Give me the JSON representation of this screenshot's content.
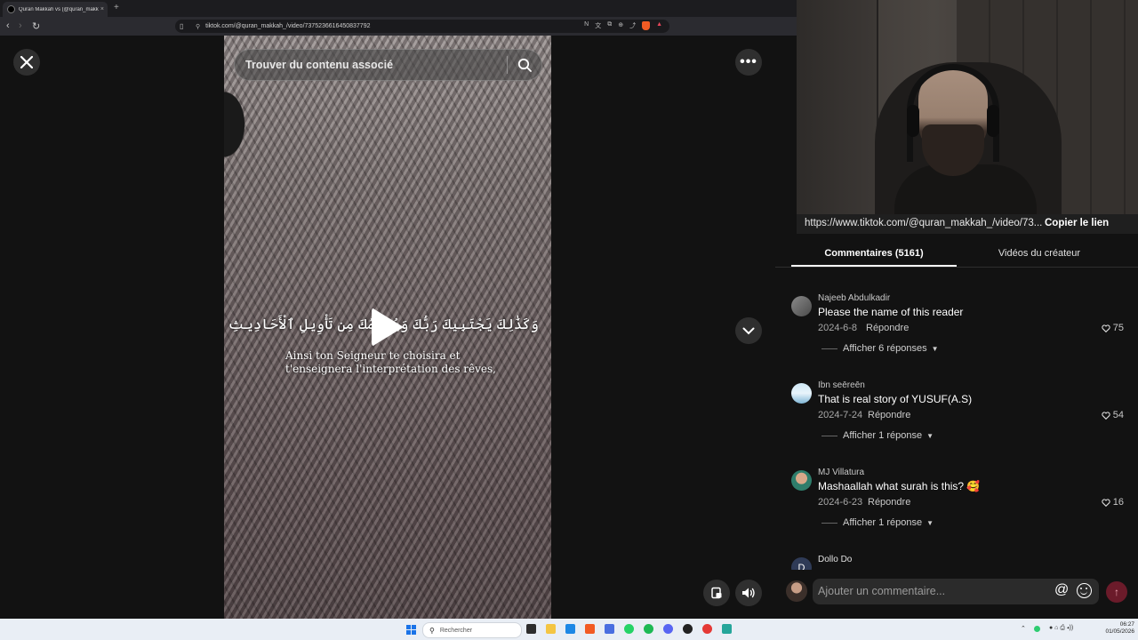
{
  "browser": {
    "tab_title": "Quran Makkah vs (@quran_makk",
    "tab_close": "×",
    "new_tab": "+",
    "back": "‹",
    "forward": "›",
    "reload": "↻",
    "url": "tiktok.com/@quran_makkah_/video/7375236616450837792"
  },
  "video": {
    "search_placeholder": "Trouver du contenu associé",
    "arabic_caption": "وَكَذَٰلِكَ يَجْتَبِيكَ رَبُّكَ وَيُعَلِّمُكَ مِن تَأْوِيلِ ٱلْأَحَادِيثِ",
    "subtitle_line1": "Ainsi ton Seigneur te choisira et",
    "subtitle_line2": "t'enseignera l'interprétation des rêves,"
  },
  "share": {
    "url": "https://www.tiktok.com/@quran_makkah_/video/73...",
    "copy_label": "Copier le lien"
  },
  "tabs": {
    "comments": "Commentaires (5161)",
    "creator_videos": "Vidéos du créateur"
  },
  "comments": [
    {
      "user": "Najeeb Abdulkadir",
      "text": "Please the name of this reader",
      "date": "2024-6-8",
      "reply": "Répondre",
      "likes": "75",
      "more": "Afficher 6 réponses"
    },
    {
      "user": "Ibn seēreēn",
      "text": "That is real story of YUSUF(A.S)",
      "date": "2024-7-24",
      "reply": "Répondre",
      "likes": "54",
      "more": "Afficher 1 réponse"
    },
    {
      "user": "MJ Villatura",
      "text": "Mashaallah what surah is this? 🥰",
      "date": "2024-6-23",
      "reply": "Répondre",
      "likes": "16",
      "more": "Afficher 1 réponse"
    },
    {
      "user": "Dollo Do",
      "avatar_letter": "D"
    }
  ],
  "input": {
    "placeholder": "Ajouter un commentaire...",
    "at": "@"
  },
  "taskbar": {
    "search_placeholder": "Rechercher",
    "time": "06:27",
    "date": "01/05/2026"
  },
  "colors": {
    "send_button": "#6b1b2a",
    "windows_accent": "#1a73e8"
  }
}
